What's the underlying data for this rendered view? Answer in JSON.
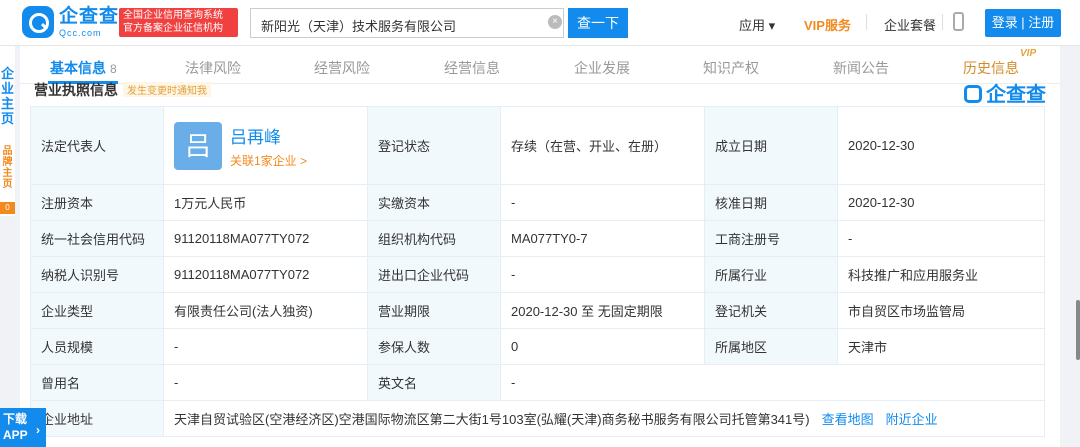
{
  "header": {
    "logo_cn": "企查查",
    "logo_en": "Qcc.com",
    "cert_line1": "全国企业信用查询系统",
    "cert_line2": "官方备案企业征信机构",
    "search_value": "新阳光（天津）技术服务有限公司",
    "search_button": "查一下",
    "nav_app": "应用 ▾",
    "nav_vip": "VIP服务",
    "nav_package": "企业套餐",
    "login": "登录 | 注册"
  },
  "tabs": [
    {
      "label": "基本信息",
      "count": "8",
      "active": true
    },
    {
      "label": "法律风险"
    },
    {
      "label": "经营风险"
    },
    {
      "label": "经营信息"
    },
    {
      "label": "企业发展"
    },
    {
      "label": "知识产权"
    },
    {
      "label": "新闻公告"
    },
    {
      "label": "历史信息",
      "badge": "VIP"
    }
  ],
  "left_side": {
    "menu": "企业主页",
    "brand": "品牌主页",
    "badge": "0"
  },
  "section": {
    "title": "营业执照信息",
    "note": "发生变更时通知我",
    "watermark": "企查查"
  },
  "info": {
    "legal_rep_label": "法定代表人",
    "legal_rep_avatar": "吕",
    "legal_rep_name": "吕再峰",
    "legal_rep_related": "关联1家企业 >",
    "status_label": "登记状态",
    "status_value": "存续（在营、开业、在册）",
    "found_label": "成立日期",
    "found_value": "2020-12-30",
    "capital_label": "注册资本",
    "capital_value": "1万元人民币",
    "paid_label": "实缴资本",
    "paid_value": "-",
    "approve_label": "核准日期",
    "approve_value": "2020-12-30",
    "credit_label": "统一社会信用代码",
    "credit_value": "91120118MA077TY072",
    "org_label": "组织机构代码",
    "org_value": "MA077TY0-7",
    "reg_label": "工商注册号",
    "reg_value": "-",
    "tax_label": "纳税人识别号",
    "tax_value": "91120118MA077TY072",
    "ie_label": "进出口企业代码",
    "ie_value": "-",
    "industry_label": "所属行业",
    "industry_value": "科技推广和应用服务业",
    "type_label": "企业类型",
    "type_value": "有限责任公司(法人独资)",
    "term_label": "营业期限",
    "term_value": "2020-12-30 至 无固定期限",
    "authority_label": "登记机关",
    "authority_value": "市自贸区市场监管局",
    "staff_label": "人员规模",
    "staff_value": "-",
    "insured_label": "参保人数",
    "insured_value": "0",
    "region_label": "所属地区",
    "region_value": "天津市",
    "former_label": "曾用名",
    "former_value": "-",
    "en_label": "英文名",
    "en_value": "-",
    "address_label": "企业地址",
    "address_value": "天津自贸试验区(空港经济区)空港国际物流区第二大街1号103室(弘耀(天津)商务秘书服务有限公司托管第341号)",
    "map_link": "查看地图",
    "nearby_link": "附近企业"
  },
  "download": {
    "line1": "下载",
    "line2": "APP"
  }
}
